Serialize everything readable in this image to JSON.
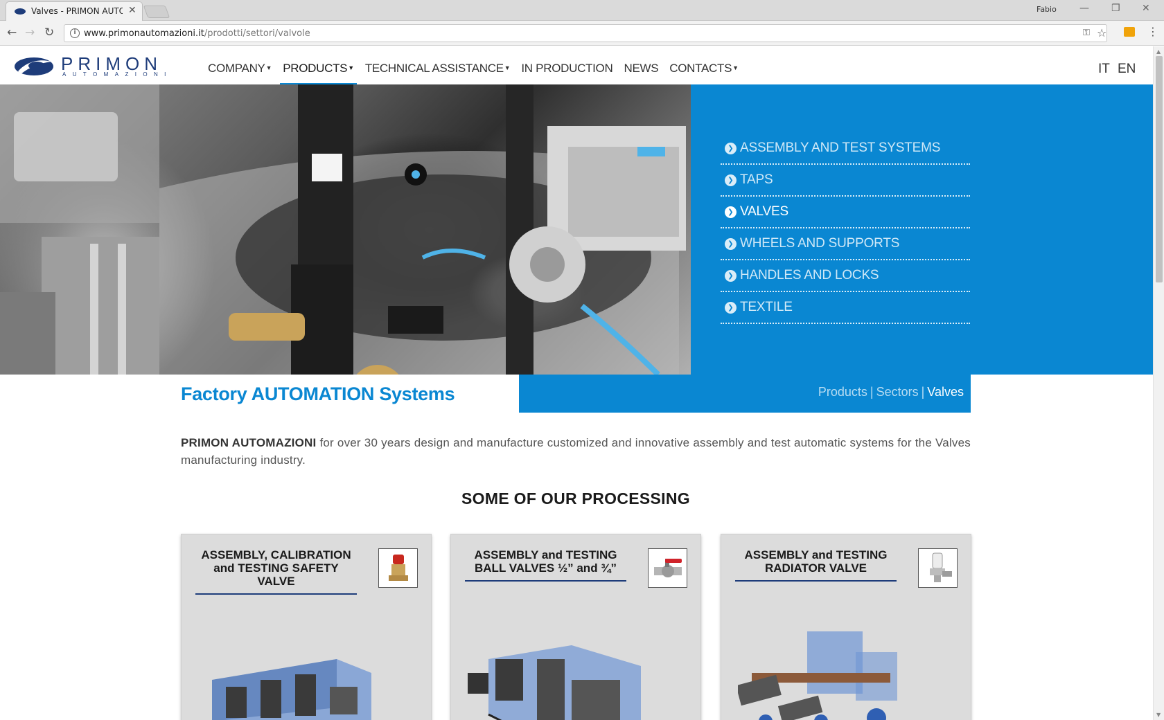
{
  "browser": {
    "tab_title": "Valves - PRIMON AUTOM",
    "profile_name": "Fabio",
    "url_host": "www.primonautomazioni.it",
    "url_path": "/prodotti/settori/valvole"
  },
  "header": {
    "logo_name": "PRIMON",
    "logo_sub": "AUTOMAZIONI",
    "nav": [
      {
        "label": "COMPANY"
      },
      {
        "label": "PRODUCTS"
      },
      {
        "label": "TECHNICAL ASSISTANCE"
      },
      {
        "label": "IN PRODUCTION"
      },
      {
        "label": "NEWS"
      },
      {
        "label": "CONTACTS"
      }
    ],
    "lang_it": "IT",
    "lang_en": "EN"
  },
  "sectors": [
    {
      "label": "ASSEMBLY AND TEST SYSTEMS"
    },
    {
      "label": "TAPS"
    },
    {
      "label": "VALVES"
    },
    {
      "label": "WHEELS AND SUPPORTS"
    },
    {
      "label": "HANDLES AND LOCKS"
    },
    {
      "label": "TEXTILE"
    }
  ],
  "title": {
    "part1": "Factory ",
    "part2": "AUTOMATION",
    "part3": " Systems"
  },
  "breadcrumb": {
    "products": "Products",
    "sep": "|",
    "sectors": "Sectors",
    "current": "Valves"
  },
  "intro": {
    "brand": "PRIMON AUTOMAZIONI",
    "text": " for over 30 years design and manufacture customized and innovative assembly and test automatic systems for the Valves manufacturing industry."
  },
  "section_heading": "SOME OF OUR PROCESSING",
  "cards": [
    {
      "title_line1": "ASSEMBLY, CALIBRATION",
      "title_line2": "and TESTING SAFETY",
      "title_line3": "VALVE",
      "thumb_icon": "safety-valve-icon"
    },
    {
      "title_line1": "ASSEMBLY and TESTING",
      "title_line2": "BALL VALVES ½” and ¾”",
      "title_line3": "",
      "thumb_icon": "ball-valve-icon"
    },
    {
      "title_line1": "ASSEMBLY and TESTING",
      "title_line2": "RADIATOR VALVE",
      "title_line3": "",
      "thumb_icon": "radiator-valve-icon"
    }
  ],
  "colors": {
    "brand_blue": "#0a87d2",
    "logo_navy": "#1e3c7a",
    "card_bg": "#dcdcdc"
  }
}
